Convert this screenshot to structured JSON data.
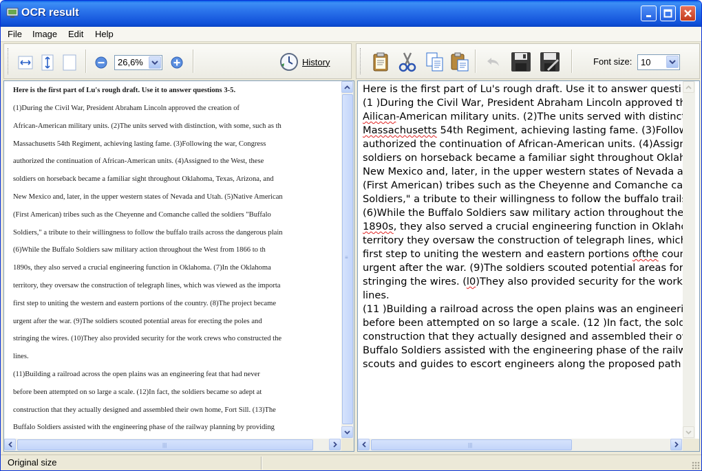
{
  "window": {
    "title": "OCR result"
  },
  "menu": [
    "File",
    "Image",
    "Edit",
    "Help"
  ],
  "image_toolbar": {
    "icons": [
      "fit-width-icon",
      "fit-height-icon",
      "original-size-icon",
      "zoom-out-icon",
      "zoom-in-icon"
    ],
    "zoom_value": "26,6%",
    "history_label": "History"
  },
  "text_toolbar": {
    "icons": [
      "clipboard-copy-icon",
      "cut-icon",
      "copy-icon",
      "paste-icon",
      "undo-icon",
      "save-icon",
      "save-as-icon"
    ],
    "font_size_label": "Font size:",
    "font_size_value": "10"
  },
  "scan": {
    "heading": "Here is the first part of Lu's rough draft. Use it to answer questions 3-5.",
    "lines": [
      "          (1)During the Civil War, President Abraham Lincoln approved the creation of",
      "African-American military units. (2)The units served with distinction, with some, such as th",
      "Massachusetts 54th Regiment, achieving lasting fame. (3)Following the war, Congress",
      "authorized the continuation of African-American units. (4)Assigned to the West, these",
      "soldiers on horseback became a familiar sight throughout Oklahoma, Texas, Arizona, and",
      "New Mexico and, later, in the upper western states of Nevada and Utah. (5)Native American",
      "(First American) tribes such as the Cheyenne and Comanche called the soldiers \"Buffalo",
      "Soldiers,\" a tribute to their willingness to follow the buffalo trails across the dangerous plain",
      "          (6)While the Buffalo Soldiers saw military action throughout the West from 1866 to th",
      "1890s, they also served a crucial engineering function in Oklahoma. (7)In the Oklahoma",
      "territory, they oversaw the construction of telegraph lines, which was viewed as the importa",
      "first step to uniting the western and eastern portions of the country. (8)The project became",
      "urgent after the war. (9)The soldiers scouted potential areas for erecting the poles and",
      "stringing the wires. (10)They also provided security for the work crews who constructed the",
      "lines.",
      "          (11)Building a railroad across the open plains was an engineering feat that had never",
      "before been attempted on so large a scale. (12)In fact, the soldiers became so adept at",
      "construction that they actually designed and assembled their own home, Fort Sill. (13)The",
      "Buffalo Soldiers assisted with the engineering phase of the railway planning by providing"
    ]
  },
  "ocr": {
    "lines": [
      [
        "Here is the first part of Lu's rough draft. Use it to answer questi"
      ],
      [
        "(1 )During the Civil War, President Abraham Lincoln approved th"
      ],
      [
        {
          "sp": "Ailican"
        },
        "-American military units. (2)The units served with distinct"
      ],
      [
        {
          "sp": "Massachusetts"
        },
        " 54th Regiment, achieving lasting fame. (3)Follow"
      ],
      [
        "authorized the continuation of African-American units. (4)Assign"
      ],
      [
        "soldiers on horseback became a familiar sight throughout Oklahe"
      ],
      [
        "New Mexico and, later, in the upper western states of Nevada ar"
      ],
      [
        "(First American) tribes such as the Cheyenne and Comanche ca"
      ],
      [
        "Soldiers,\" a tribute to their willingness to follow the buffalo trails"
      ],
      [
        "(6)While the Buffalo Soldiers saw military action throughout the"
      ],
      [
        {
          "sp": "1890s"
        },
        ", they also served a crucial engineering function in Oklaho"
      ],
      [
        "territory they oversaw the construction of telegraph lines, which"
      ],
      [
        "first step to uniting the western and eastern portions ",
        {
          "sp": "ofthe"
        },
        " coun"
      ],
      [
        "urgent after the war. (9)The soldiers scouted potential areas for"
      ],
      [
        "stringing the wires. (",
        {
          "sp": "l0"
        },
        ")They also provided security for the work"
      ],
      [
        "lines."
      ],
      [
        "(11 )Building a railroad across the open plains was an engineeri"
      ],
      [
        "before been attempted on so large a scale. (12 )In fact, the sold"
      ],
      [
        "construction that they actually designed and assembled their ow"
      ],
      [
        "Buffalo Soldiers assisted with the engineering phase of the railw"
      ],
      [
        "scouts and guides to escort engineers along the proposed path c"
      ]
    ]
  },
  "status": {
    "text": "Original size"
  },
  "colors": {
    "titlebar": "#2a72ea",
    "spell_underline": "#e02020"
  }
}
